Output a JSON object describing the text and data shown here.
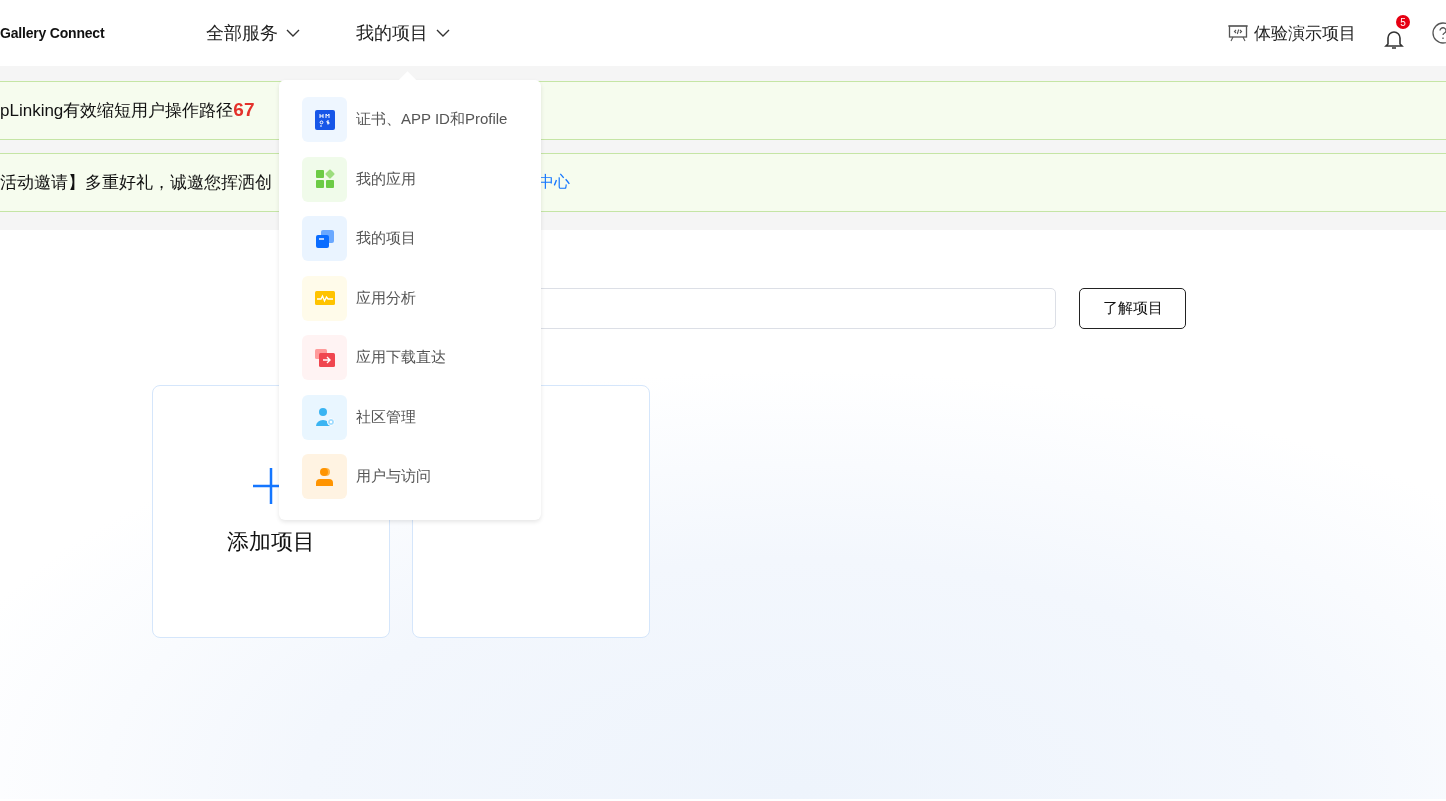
{
  "header": {
    "logo_text": "Gallery Connect",
    "nav": [
      "全部服务",
      "我的项目"
    ],
    "demo_link": "体验演示项目",
    "notification_count": "5"
  },
  "banners": [
    {
      "text": "pLinking有效缩短用户操作路径**67**"
    },
    {
      "text": "活动邀请】多重好礼，诚邀您挥洒创",
      "link": "中心"
    }
  ],
  "search": {
    "button": "了解项目"
  },
  "cards": [
    {
      "kind": "add",
      "label": "添加项目"
    },
    {
      "kind": "empty"
    }
  ],
  "dropdown": {
    "items": [
      {
        "kind": "hmos",
        "label": "证书、APP ID和Profile"
      },
      {
        "kind": "apps",
        "label": "我的应用"
      },
      {
        "kind": "projects",
        "label": "我的项目"
      },
      {
        "kind": "analytics",
        "label": "应用分析"
      },
      {
        "kind": "download",
        "label": "应用下载直达"
      },
      {
        "kind": "community",
        "label": "社区管理"
      },
      {
        "kind": "users",
        "label": "用户与访问"
      }
    ]
  }
}
